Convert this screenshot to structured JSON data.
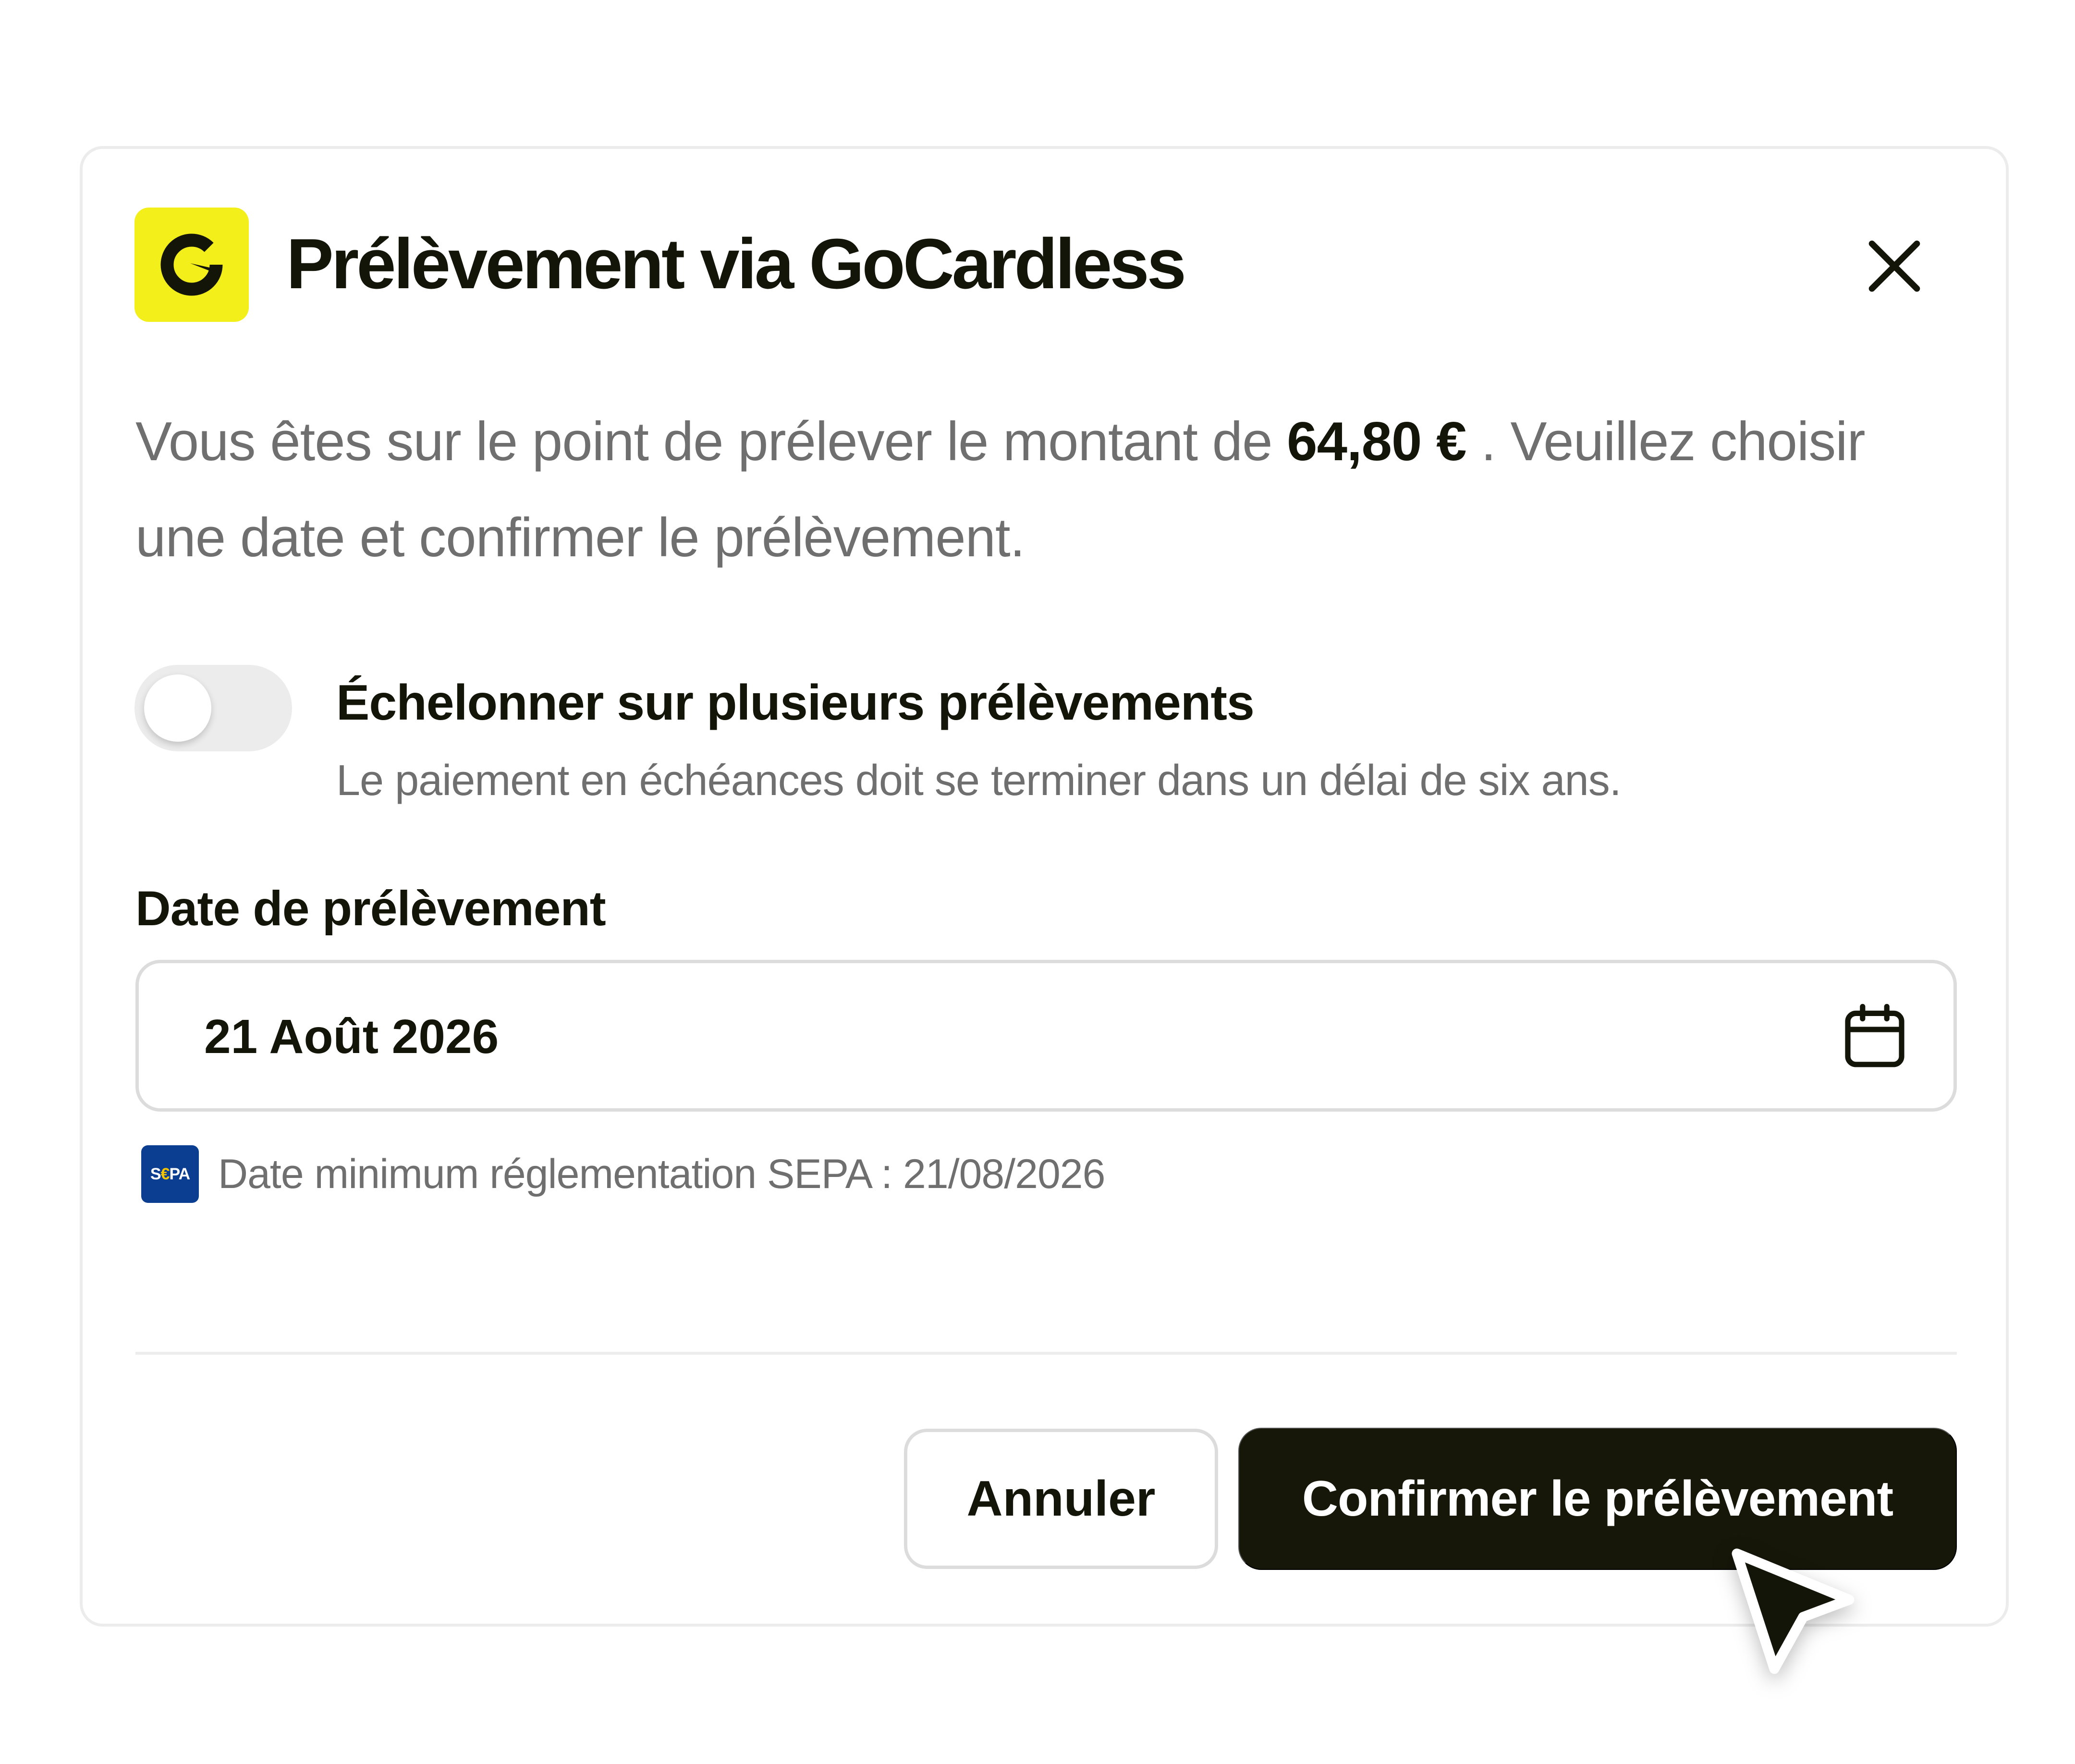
{
  "modal": {
    "title": "Prélèvement via GoCardless",
    "logo_icon": "gocardless-logo-icon",
    "close_icon": "close-icon",
    "brand_color": "#f3ef1b"
  },
  "intro": {
    "before_amount": "Vous êtes sur le point de prélever le montant de ",
    "amount": "64,80 €",
    "after_amount": " . Veuillez choisir une date et confirmer le prélèvement."
  },
  "installments": {
    "label": "Échelonner sur plusieurs prélèvements",
    "description": "Le paiement en échéances doit se terminer dans un délai de six ans.",
    "enabled": false
  },
  "date_field": {
    "label": "Date de prélèvement",
    "value": "21 Août 2026",
    "icon": "calendar-icon"
  },
  "sepa": {
    "logo_s": "S",
    "logo_e": "€",
    "logo_pa": "PA",
    "hint": "Date minimum réglementation SEPA : 21/08/2026"
  },
  "actions": {
    "cancel_label": "Annuler",
    "confirm_label": "Confirmer le prélèvement",
    "confirm_color": "#161709"
  }
}
